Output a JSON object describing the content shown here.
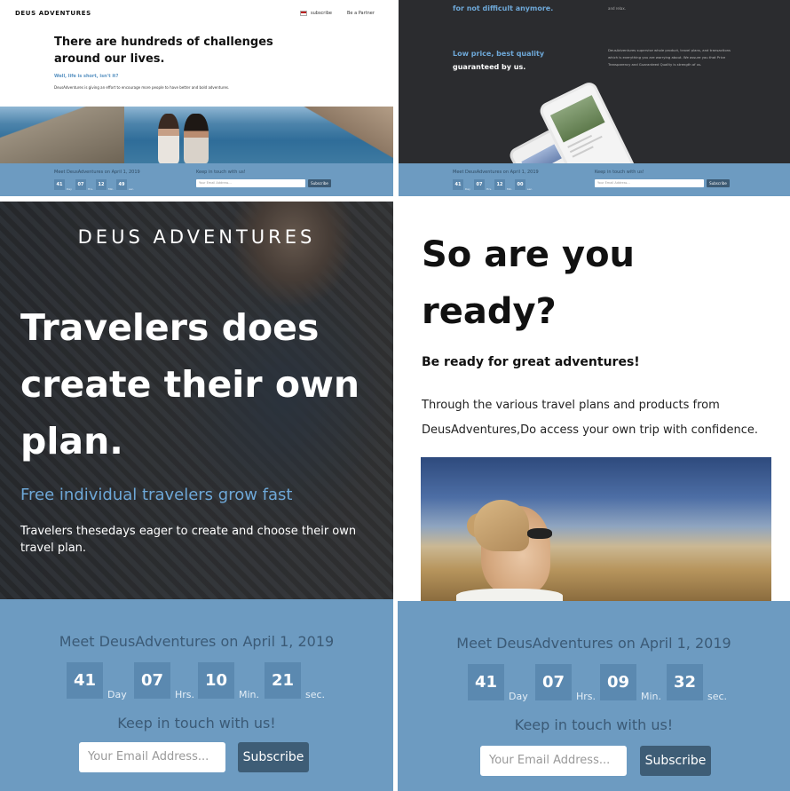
{
  "brand": "DEUS ADVENTURES",
  "nav": {
    "subscribe": "subscribe",
    "partner": "Be a Partner"
  },
  "p1": {
    "title": "There are hundreds of challenges around our lives.",
    "tagline": "Well, life is short, isn't it?",
    "desc": "DeusAdventures is giving an effort to encourage more people to have better and bold adventures."
  },
  "p2": {
    "top_heading": "for not difficult anymore.",
    "top_note": "and relax.",
    "heading_blue": "Low price, best quality",
    "heading_white": "guaranteed by us.",
    "desc": "DeusAdventures supervise whole product, travel plans, and transactions which is everything you are worrying about. We assure you that Price Transparency and Guaranteed Quality is strength of us."
  },
  "p3": {
    "logo": "DEUS ADVENTURES",
    "title": "Travelers does create their own plan.",
    "subtitle": "Free individual travelers grow fast",
    "desc": "Travelers thesedays eager to create and choose their own travel plan."
  },
  "p4": {
    "title": "So are you ready?",
    "subtitle": "Be ready for great adventures!",
    "desc": "Through the various travel plans and products from DeusAdventures,Do access your own trip with confidence."
  },
  "countdown": {
    "meet": "Meet DeusAdventures on April 1, 2019",
    "keep": "Keep in touch with us!",
    "placeholder": "Your Email Address...",
    "button": "Subscribe",
    "units": {
      "day": "Day",
      "hrs": "Hrs.",
      "min": "Min.",
      "sec": "sec."
    },
    "p1": {
      "day": "41",
      "hrs": "07",
      "min": "12",
      "sec": "49"
    },
    "p2": {
      "day": "41",
      "hrs": "07",
      "min": "12",
      "sec": "00"
    },
    "p3": {
      "day": "41",
      "hrs": "07",
      "min": "10",
      "sec": "21"
    },
    "p4": {
      "day": "41",
      "hrs": "07",
      "min": "09",
      "sec": "32"
    }
  },
  "colors": {
    "accent": "#6ea8d8",
    "band": "#6d9bc1",
    "box": "#5b89b0",
    "button": "#3e5d76",
    "dark": "#2b2c2f"
  }
}
